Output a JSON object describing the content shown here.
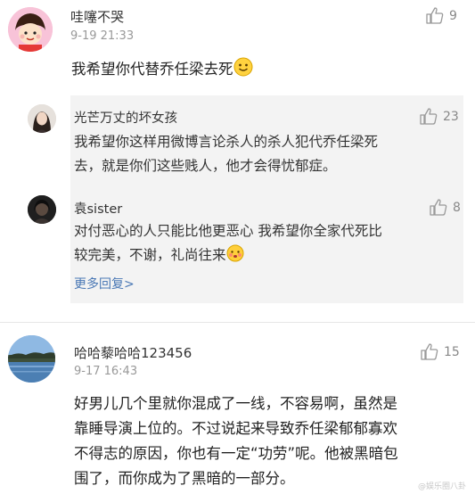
{
  "comments": [
    {
      "username": "哇噻不哭",
      "time": "9-19 21:33",
      "likes": "9",
      "text": "我希望你代替乔任梁去死"
    },
    {
      "username": "哈哈藜哈哈123456",
      "time": "9-17 16:43",
      "likes": "15",
      "text_lines": [
        "好男儿几个里就你混成了一线，不容易啊，虽然是",
        "靠睡导演上位的。不过说起来导致乔任梁郁郁寡欢",
        "不得志的原因，你也有一定“功劳”呢。他被黑暗包",
        "围了，而你成为了黑暗的一部分。"
      ]
    }
  ],
  "replies": [
    {
      "username": "光芒万丈的坏女孩",
      "likes": "23",
      "text_lines": [
        "我希望你这样用微博言论杀人的杀人犯代乔任梁死",
        "去，就是你们这些贱人，他才会得忧郁症。"
      ]
    },
    {
      "username": "袁sister",
      "likes": "8",
      "text_lines": [
        "对付恶心的人只能比他更恶心 我希望你全家代死比",
        "较完美，不谢，礼尚往来"
      ]
    }
  ],
  "more_replies_label": "更多回复>",
  "watermark": "@娱乐圈八卦",
  "colors": {
    "link": "#4a78b5",
    "muted": "#999999",
    "reply_bg": "#f3f3f3"
  }
}
